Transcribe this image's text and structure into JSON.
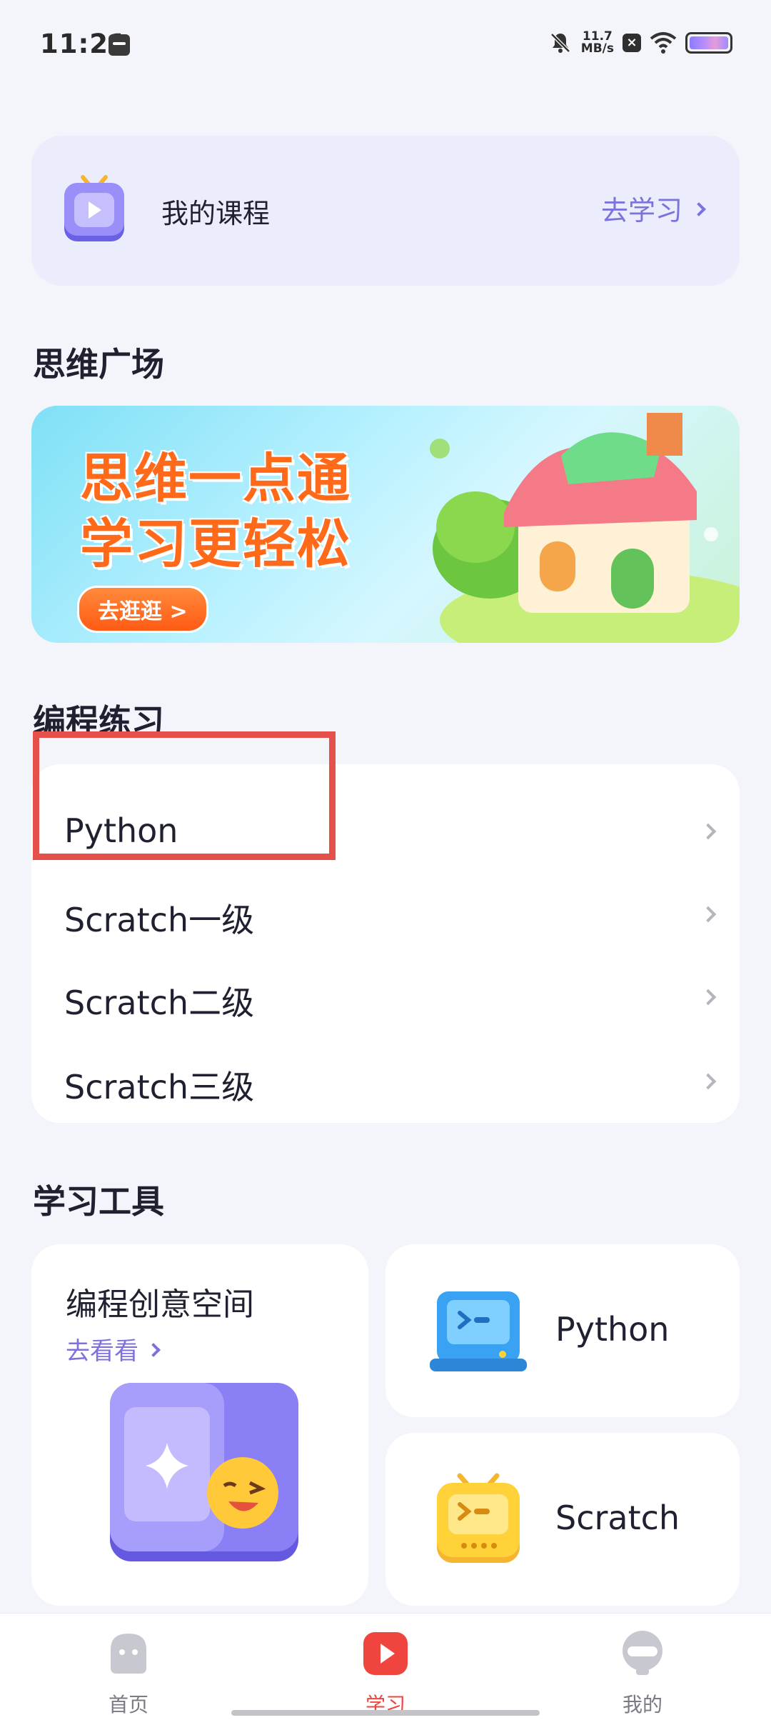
{
  "status_bar": {
    "time": "11:21",
    "speed_value": "11.7",
    "speed_unit": "MB/s"
  },
  "course_card": {
    "title": "我的课程",
    "link": "去学习"
  },
  "sections": {
    "thinking": "思维广场",
    "coding": "编程练习",
    "tools": "学习工具"
  },
  "banner": {
    "line1": "思维一点通",
    "line2": "学习更轻松",
    "button": "去逛逛 >"
  },
  "coding_list": [
    {
      "label": "Python"
    },
    {
      "label": "Scratch一级"
    },
    {
      "label": "Scratch二级"
    },
    {
      "label": "Scratch三级"
    }
  ],
  "tools": {
    "creative_title": "编程创意空间",
    "creative_link": "去看看",
    "python": "Python",
    "scratch": "Scratch"
  },
  "bottom_nav": {
    "home": "首页",
    "study": "学习",
    "mine": "我的"
  },
  "colors": {
    "accent_purple": "#7d72dd",
    "active_red": "#f0443f",
    "highlight_red": "#e5504a",
    "banner_orange": "#ff6a1a"
  }
}
